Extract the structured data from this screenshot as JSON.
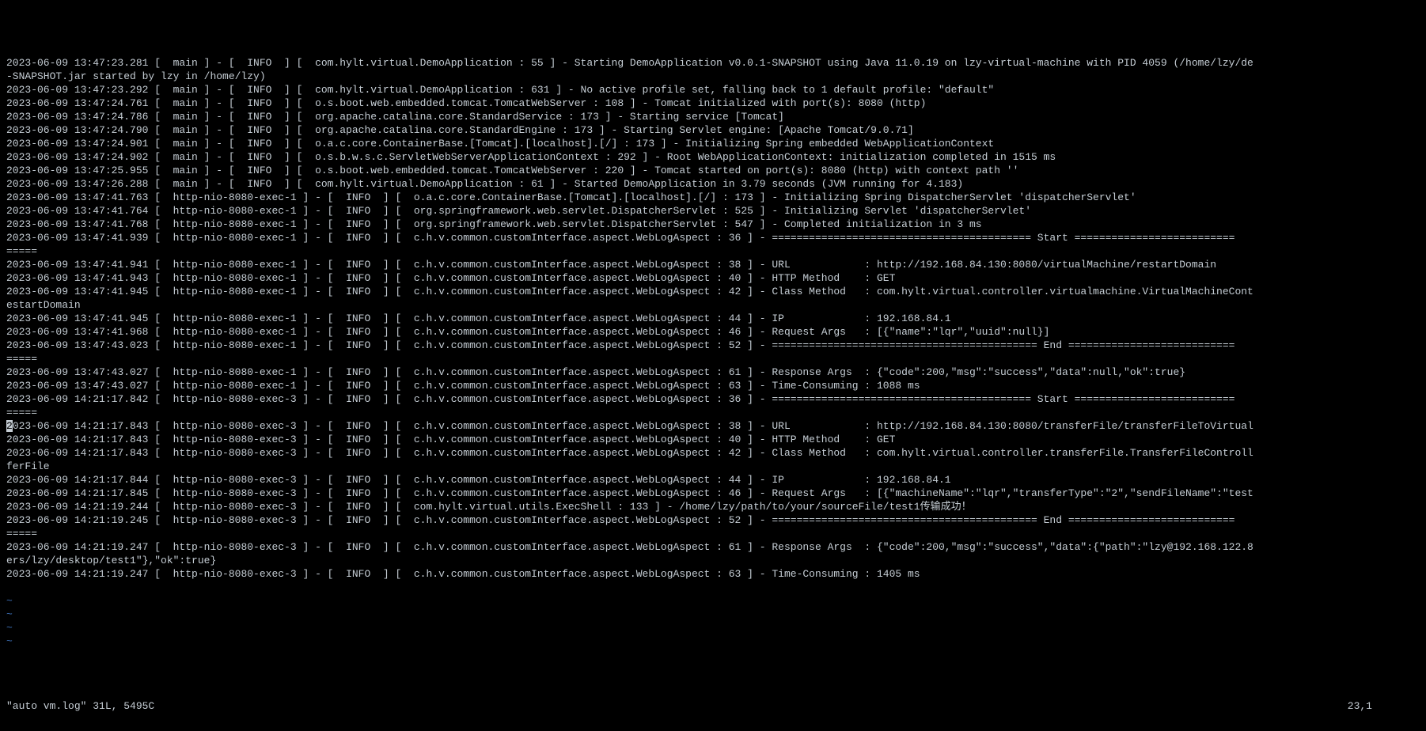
{
  "log_lines": [
    "2023-06-09 13:47:23.281 [  main ] - [  INFO  ] [  com.hylt.virtual.DemoApplication : 55 ] - Starting DemoApplication v0.0.1-SNAPSHOT using Java 11.0.19 on lzy-virtual-machine with PID 4059 (/home/lzy/de",
    "-SNAPSHOT.jar started by lzy in /home/lzy)",
    "2023-06-09 13:47:23.292 [  main ] - [  INFO  ] [  com.hylt.virtual.DemoApplication : 631 ] - No active profile set, falling back to 1 default profile: \"default\"",
    "2023-06-09 13:47:24.761 [  main ] - [  INFO  ] [  o.s.boot.web.embedded.tomcat.TomcatWebServer : 108 ] - Tomcat initialized with port(s): 8080 (http)",
    "2023-06-09 13:47:24.786 [  main ] - [  INFO  ] [  org.apache.catalina.core.StandardService : 173 ] - Starting service [Tomcat]",
    "2023-06-09 13:47:24.790 [  main ] - [  INFO  ] [  org.apache.catalina.core.StandardEngine : 173 ] - Starting Servlet engine: [Apache Tomcat/9.0.71]",
    "2023-06-09 13:47:24.901 [  main ] - [  INFO  ] [  o.a.c.core.ContainerBase.[Tomcat].[localhost].[/] : 173 ] - Initializing Spring embedded WebApplicationContext",
    "2023-06-09 13:47:24.902 [  main ] - [  INFO  ] [  o.s.b.w.s.c.ServletWebServerApplicationContext : 292 ] - Root WebApplicationContext: initialization completed in 1515 ms",
    "2023-06-09 13:47:25.955 [  main ] - [  INFO  ] [  o.s.boot.web.embedded.tomcat.TomcatWebServer : 220 ] - Tomcat started on port(s): 8080 (http) with context path ''",
    "2023-06-09 13:47:26.288 [  main ] - [  INFO  ] [  com.hylt.virtual.DemoApplication : 61 ] - Started DemoApplication in 3.79 seconds (JVM running for 4.183)",
    "2023-06-09 13:47:41.763 [  http-nio-8080-exec-1 ] - [  INFO  ] [  o.a.c.core.ContainerBase.[Tomcat].[localhost].[/] : 173 ] - Initializing Spring DispatcherServlet 'dispatcherServlet'",
    "2023-06-09 13:47:41.764 [  http-nio-8080-exec-1 ] - [  INFO  ] [  org.springframework.web.servlet.DispatcherServlet : 525 ] - Initializing Servlet 'dispatcherServlet'",
    "2023-06-09 13:47:41.768 [  http-nio-8080-exec-1 ] - [  INFO  ] [  org.springframework.web.servlet.DispatcherServlet : 547 ] - Completed initialization in 3 ms",
    "2023-06-09 13:47:41.939 [  http-nio-8080-exec-1 ] - [  INFO  ] [  c.h.v.common.customInterface.aspect.WebLogAspect : 36 ] - ========================================== Start ==========================",
    "=====",
    "2023-06-09 13:47:41.941 [  http-nio-8080-exec-1 ] - [  INFO  ] [  c.h.v.common.customInterface.aspect.WebLogAspect : 38 ] - URL            : http://192.168.84.130:8080/virtualMachine/restartDomain",
    "2023-06-09 13:47:41.943 [  http-nio-8080-exec-1 ] - [  INFO  ] [  c.h.v.common.customInterface.aspect.WebLogAspect : 40 ] - HTTP Method    : GET",
    "2023-06-09 13:47:41.945 [  http-nio-8080-exec-1 ] - [  INFO  ] [  c.h.v.common.customInterface.aspect.WebLogAspect : 42 ] - Class Method   : com.hylt.virtual.controller.virtualmachine.VirtualMachineCont",
    "estartDomain",
    "2023-06-09 13:47:41.945 [  http-nio-8080-exec-1 ] - [  INFO  ] [  c.h.v.common.customInterface.aspect.WebLogAspect : 44 ] - IP             : 192.168.84.1",
    "2023-06-09 13:47:41.968 [  http-nio-8080-exec-1 ] - [  INFO  ] [  c.h.v.common.customInterface.aspect.WebLogAspect : 46 ] - Request Args   : [{\"name\":\"lqr\",\"uuid\":null}]",
    "2023-06-09 13:47:43.023 [  http-nio-8080-exec-1 ] - [  INFO  ] [  c.h.v.common.customInterface.aspect.WebLogAspect : 52 ] - =========================================== End ===========================",
    "=====",
    "2023-06-09 13:47:43.027 [  http-nio-8080-exec-1 ] - [  INFO  ] [  c.h.v.common.customInterface.aspect.WebLogAspect : 61 ] - Response Args  : {\"code\":200,\"msg\":\"success\",\"data\":null,\"ok\":true}",
    "2023-06-09 13:47:43.027 [  http-nio-8080-exec-1 ] - [  INFO  ] [  c.h.v.common.customInterface.aspect.WebLogAspect : 63 ] - Time-Consuming : 1088 ms",
    "2023-06-09 14:21:17.842 [  http-nio-8080-exec-3 ] - [  INFO  ] [  c.h.v.common.customInterface.aspect.WebLogAspect : 36 ] - ========================================== Start ==========================",
    "=====",
    "2023-06-09 14:21:17.843 [  http-nio-8080-exec-3 ] - [  INFO  ] [  c.h.v.common.customInterface.aspect.WebLogAspect : 38 ] - URL            : http://192.168.84.130:8080/transferFile/transferFileToVirtual",
    "2023-06-09 14:21:17.843 [  http-nio-8080-exec-3 ] - [  INFO  ] [  c.h.v.common.customInterface.aspect.WebLogAspect : 40 ] - HTTP Method    : GET",
    "2023-06-09 14:21:17.843 [  http-nio-8080-exec-3 ] - [  INFO  ] [  c.h.v.common.customInterface.aspect.WebLogAspect : 42 ] - Class Method   : com.hylt.virtual.controller.transferFile.TransferFileControll",
    "ferFile",
    "2023-06-09 14:21:17.844 [  http-nio-8080-exec-3 ] - [  INFO  ] [  c.h.v.common.customInterface.aspect.WebLogAspect : 44 ] - IP             : 192.168.84.1",
    "2023-06-09 14:21:17.845 [  http-nio-8080-exec-3 ] - [  INFO  ] [  c.h.v.common.customInterface.aspect.WebLogAspect : 46 ] - Request Args   : [{\"machineName\":\"lqr\",\"transferType\":\"2\",\"sendFileName\":\"test",
    "2023-06-09 14:21:19.244 [  http-nio-8080-exec-3 ] - [  INFO  ] [  com.hylt.virtual.utils.ExecShell : 133 ] - /home/lzy/path/to/your/sourceFile/test1传输成功！",
    "2023-06-09 14:21:19.245 [  http-nio-8080-exec-3 ] - [  INFO  ] [  c.h.v.common.customInterface.aspect.WebLogAspect : 52 ] - =========================================== End ===========================",
    "=====",
    "2023-06-09 14:21:19.247 [  http-nio-8080-exec-3 ] - [  INFO  ] [  c.h.v.common.customInterface.aspect.WebLogAspect : 61 ] - Response Args  : {\"code\":200,\"msg\":\"success\",\"data\":{\"path\":\"lzy@192.168.122.8",
    "ers/lzy/desktop/test1\"},\"ok\":true}",
    "2023-06-09 14:21:19.247 [  http-nio-8080-exec-3 ] - [  INFO  ] [  c.h.v.common.customInterface.aspect.WebLogAspect : 63 ] - Time-Consuming : 1405 ms"
  ],
  "empty_lines": [
    "~",
    "~",
    "~",
    "~"
  ],
  "status": {
    "file_message": "\"auto vm.log\" 31L, 5495C",
    "cursor_pos": "23,1"
  },
  "cursor_line_index": 27,
  "cursor_char": "2"
}
